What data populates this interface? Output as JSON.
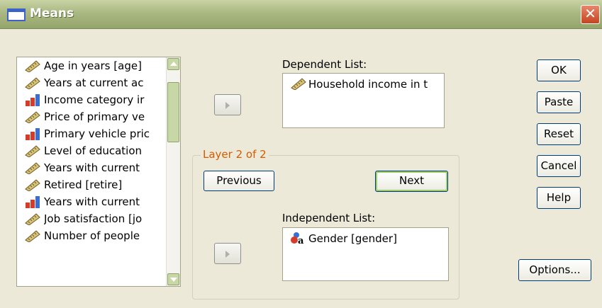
{
  "window": {
    "title": "Means",
    "close_label": "✕"
  },
  "variable_list": {
    "items": [
      {
        "label": "Age in years [age]",
        "icon": "scale-ruler-icon"
      },
      {
        "label": "Years at current ac",
        "icon": "scale-ruler-icon"
      },
      {
        "label": "Income category ir",
        "icon": "ordinal-bar-icon"
      },
      {
        "label": "Price of primary ve",
        "icon": "scale-ruler-icon"
      },
      {
        "label": "Primary vehicle pric",
        "icon": "ordinal-bar-icon"
      },
      {
        "label": "Level of education",
        "icon": "scale-ruler-icon"
      },
      {
        "label": "Years with current",
        "icon": "scale-ruler-icon"
      },
      {
        "label": "Retired [retire]",
        "icon": "scale-ruler-icon"
      },
      {
        "label": "Years with current",
        "icon": "ordinal-bar-icon"
      },
      {
        "label": "Job satisfaction [jo",
        "icon": "scale-ruler-icon"
      },
      {
        "label": "Number of people",
        "icon": "scale-ruler-icon"
      }
    ]
  },
  "dependent": {
    "label": "Dependent List:",
    "items": [
      {
        "label": "Household income in t",
        "icon": "scale-ruler-icon"
      }
    ]
  },
  "layer": {
    "label": "Layer 2 of 2",
    "previous": "Previous",
    "next": "Next"
  },
  "independent": {
    "label": "Independent List:",
    "items": [
      {
        "label": "Gender [gender]",
        "icon": "nominal-icon"
      }
    ]
  },
  "buttons": {
    "ok": "OK",
    "paste": "Paste",
    "reset": "Reset",
    "cancel": "Cancel",
    "help": "Help",
    "options": "Options..."
  },
  "colors": {
    "title_bar": "#a9b882",
    "dialog_bg": "#ece9d8",
    "layer_label": "#d65a00"
  }
}
